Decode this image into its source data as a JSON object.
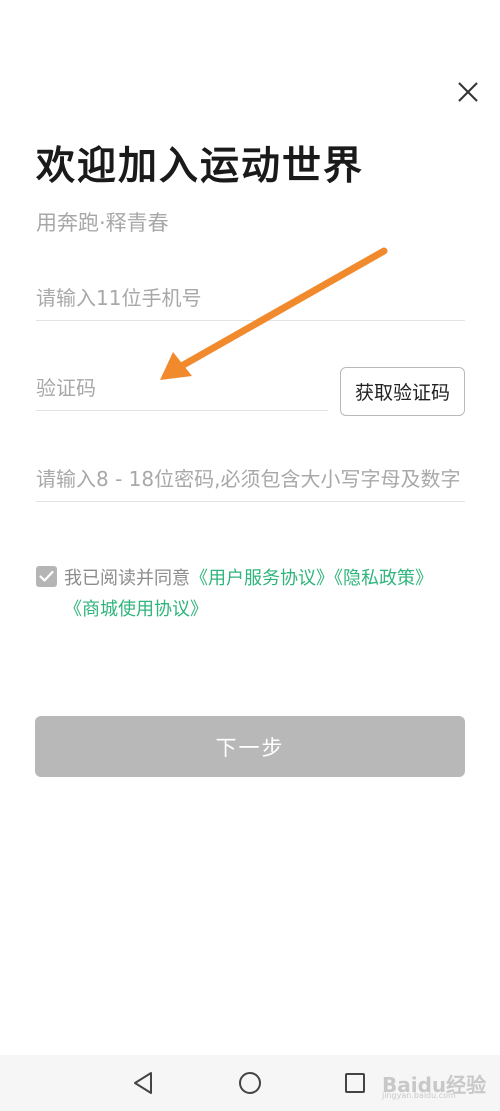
{
  "header": {
    "close_icon": "close-icon"
  },
  "title": "欢迎加入运动世界",
  "subtitle": "用奔跑·释青春",
  "form": {
    "phone_placeholder": "请输入11位手机号",
    "phone_value": "",
    "code_placeholder": "验证码",
    "code_value": "",
    "get_code_label": "获取验证码",
    "password_placeholder": "请输入8 - 18位密码,必须包含大小写字母及数字",
    "password_value": ""
  },
  "agreement": {
    "checked": true,
    "prefix": "我已阅读并同意",
    "link1": "《用户服务协议》",
    "link2": "《隐私政策》",
    "link3": "《商城使用协议》"
  },
  "next_label": "下一步",
  "nav": {
    "back_icon": "triangle-back-icon",
    "home_icon": "circle-home-icon",
    "recent_icon": "square-recent-icon"
  },
  "watermark": {
    "text": "Baidu经验",
    "sub": "jingyan.baidu.com"
  },
  "colors": {
    "link": "#2fb47c",
    "button_disabled": "#b8b8b8",
    "annotation_arrow": "#f08a2c"
  }
}
